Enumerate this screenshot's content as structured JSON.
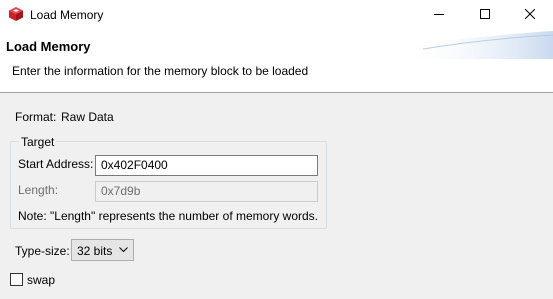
{
  "window": {
    "title": "Load Memory",
    "icon": "red-cube-icon",
    "controls": [
      "minimize-icon",
      "maximize-icon",
      "close-icon"
    ]
  },
  "header": {
    "title": "Load Memory",
    "description": "Enter the information for the memory block to be loaded"
  },
  "format": {
    "label": "Format:",
    "value": "Raw Data"
  },
  "target": {
    "group_title": "Target",
    "start_label": "Start Address:",
    "start_value": "0x402F0400",
    "length_label": "Length:",
    "length_value": "0x7d9b",
    "note": "Note: \"Length\" represents the number of memory words."
  },
  "type_size": {
    "label": "Type-size:",
    "value": "32 bits"
  },
  "swap": {
    "label": "swap",
    "checked": false
  },
  "colors": {
    "icon_red": "#cc2229",
    "window_bg": "#f0f0f0",
    "header_bg": "#ffffff"
  }
}
